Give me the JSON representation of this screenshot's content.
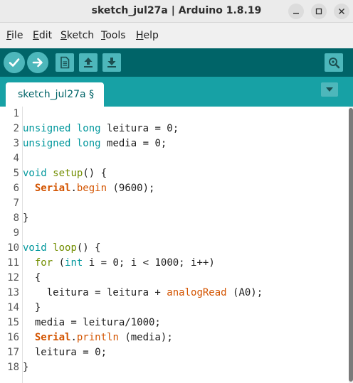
{
  "window": {
    "title": "sketch_jul27a | Arduino 1.8.19",
    "buttons": [
      "minimize",
      "maximize",
      "close"
    ]
  },
  "menu": [
    {
      "label": "File",
      "mnemonic": "F",
      "rest": "ile"
    },
    {
      "label": "Edit",
      "mnemonic": "E",
      "rest": "dit"
    },
    {
      "label": "Sketch",
      "mnemonic": "S",
      "rest": "ketch"
    },
    {
      "label": "Tools",
      "mnemonic": "T",
      "rest": "ools"
    },
    {
      "label": "Help",
      "mnemonic": "H",
      "rest": "elp"
    }
  ],
  "toolbar": {
    "buttons": [
      "verify-icon",
      "upload-icon",
      "new-icon",
      "open-icon",
      "save-icon"
    ],
    "right": "serial-monitor-icon"
  },
  "tabs": [
    {
      "label": "sketch_jul27a §"
    }
  ],
  "colors": {
    "toolbar": "#006468",
    "tabbar": "#17a1a5",
    "button": "#4db7bb",
    "type_keyword": "#00979c",
    "control_keyword": "#728e00",
    "function": "#d35400"
  },
  "code": {
    "line_numbers": [
      "1",
      "2",
      "3",
      "4",
      "5",
      "6",
      "7",
      "8",
      "9",
      "10",
      "11",
      "12",
      "13",
      "14",
      "15",
      "16",
      "17",
      "18"
    ],
    "lines": [
      [],
      [
        {
          "t": "unsigned",
          "c": "k-type"
        },
        {
          "t": " "
        },
        {
          "t": "long",
          "c": "k-type"
        },
        {
          "t": " leitura = 0;"
        }
      ],
      [
        {
          "t": "unsigned",
          "c": "k-type"
        },
        {
          "t": " "
        },
        {
          "t": "long",
          "c": "k-type"
        },
        {
          "t": " media = 0;"
        }
      ],
      [],
      [
        {
          "t": "void",
          "c": "k-type"
        },
        {
          "t": " "
        },
        {
          "t": "setup",
          "c": "k-ctrl"
        },
        {
          "t": "() {"
        }
      ],
      [
        {
          "t": "  "
        },
        {
          "t": "Serial",
          "c": "k-serial"
        },
        {
          "t": "."
        },
        {
          "t": "begin",
          "c": "k-func"
        },
        {
          "t": " (9600);"
        }
      ],
      [],
      [
        {
          "t": "}"
        }
      ],
      [],
      [
        {
          "t": "void",
          "c": "k-type"
        },
        {
          "t": " "
        },
        {
          "t": "loop",
          "c": "k-ctrl"
        },
        {
          "t": "() {"
        }
      ],
      [
        {
          "t": "  "
        },
        {
          "t": "for",
          "c": "k-ctrl"
        },
        {
          "t": " ("
        },
        {
          "t": "int",
          "c": "k-type"
        },
        {
          "t": " i = 0; i < 1000; i++)"
        }
      ],
      [
        {
          "t": "  {"
        }
      ],
      [
        {
          "t": "    leitura = leitura + "
        },
        {
          "t": "analogRead",
          "c": "k-func"
        },
        {
          "t": " (A0);"
        }
      ],
      [
        {
          "t": "  }"
        }
      ],
      [
        {
          "t": "  media = leitura/1000;"
        }
      ],
      [
        {
          "t": "  "
        },
        {
          "t": "Serial",
          "c": "k-serial"
        },
        {
          "t": "."
        },
        {
          "t": "println",
          "c": "k-func"
        },
        {
          "t": " (media);"
        }
      ],
      [
        {
          "t": "  leitura = 0;"
        }
      ],
      [
        {
          "t": "}"
        }
      ]
    ]
  }
}
